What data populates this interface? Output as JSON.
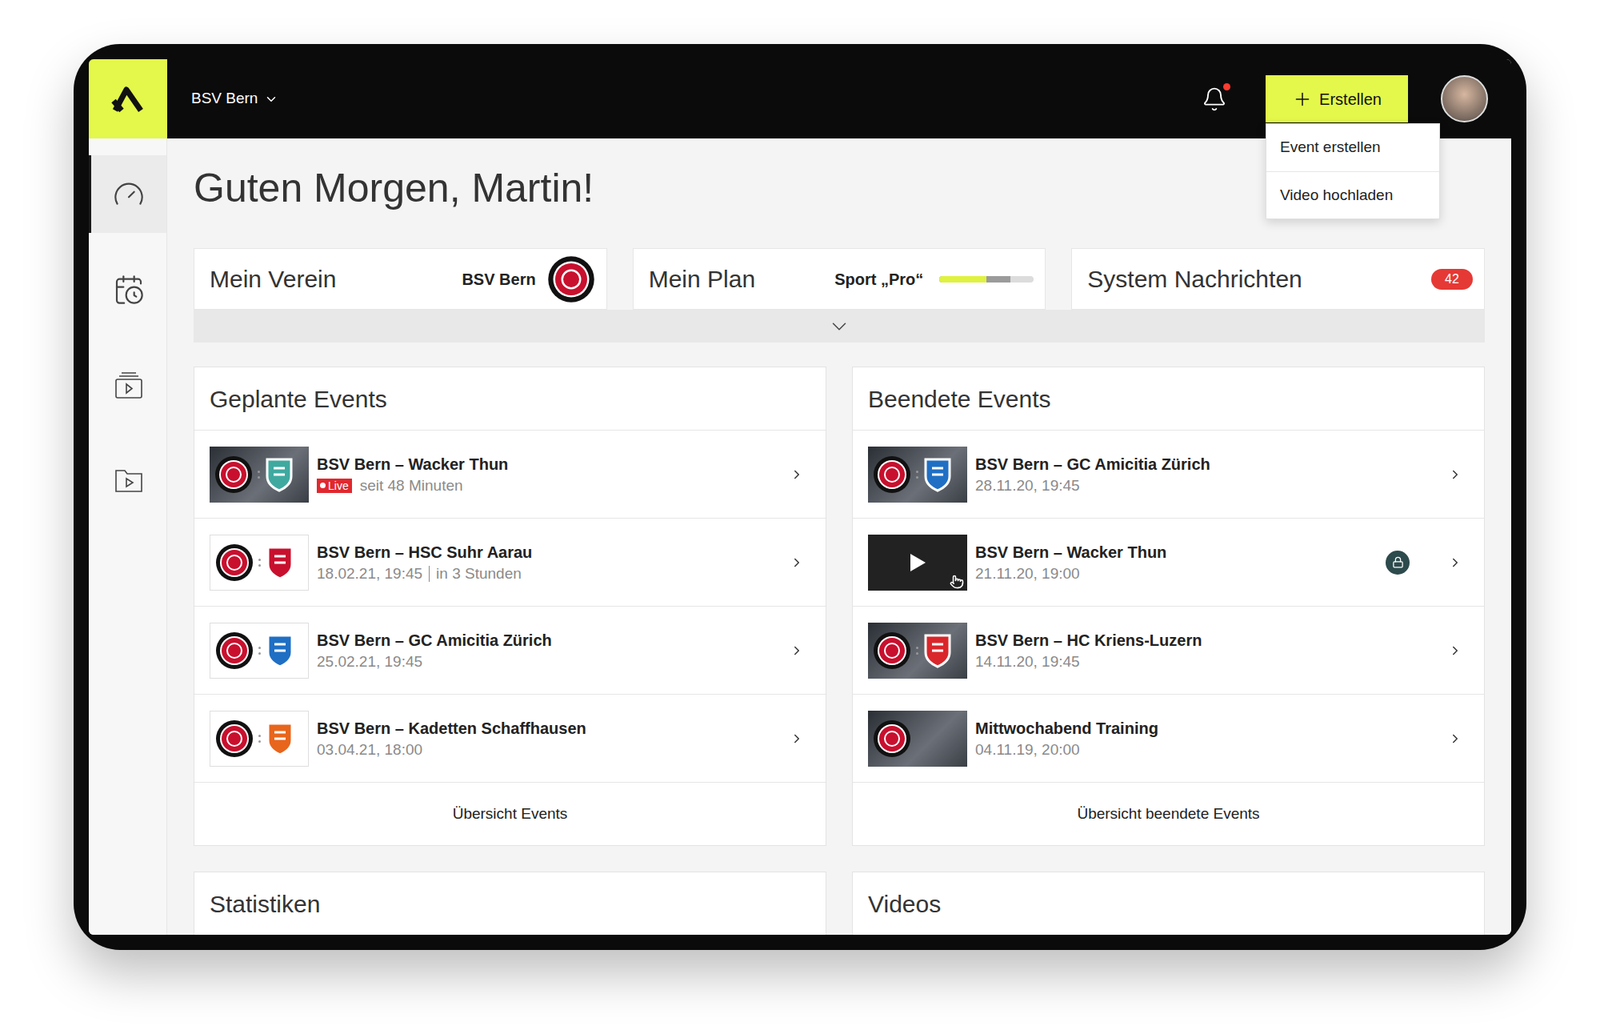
{
  "org_switcher": {
    "label": "BSV Bern",
    "expanded": false
  },
  "notifications": {
    "unread": true
  },
  "create_button": {
    "label": "Erstellen",
    "expanded": true,
    "menu": [
      "Event erstellen",
      "Video hochladen"
    ]
  },
  "sidebar": {
    "items": [
      {
        "kind": "dashboard",
        "selected": true
      },
      {
        "kind": "schedule",
        "selected": false
      },
      {
        "kind": "videos",
        "selected": false
      },
      {
        "kind": "media",
        "selected": false
      }
    ]
  },
  "greeting": "Guten Morgen, Martin!",
  "info_cards": [
    {
      "kind": "club",
      "title": "Mein Verein",
      "value": "BSV Bern"
    },
    {
      "kind": "plan",
      "title": "Mein Plan",
      "value": "Sport „Pro“",
      "level": 0.5,
      "secondary_level": 0.75
    },
    {
      "kind": "messages",
      "title": "System Nachrichten",
      "badge": "42"
    }
  ],
  "info_strip": {
    "expanded": false
  },
  "planned_events": {
    "title": "Geplante Events",
    "footer": "Übersicht Events",
    "items": [
      {
        "kind": "photo",
        "title": "BSV Bern – Wacker Thun",
        "live": true,
        "live_label": "Live",
        "date": "seit 48 Minuten",
        "relative": "",
        "locked": false,
        "color": "#3fa9a0"
      },
      {
        "kind": "plain",
        "title": "BSV Bern – HSC Suhr Aarau",
        "live": false,
        "live_label": "",
        "date": "18.02.21, 19:45",
        "relative": "in 3 Stunden",
        "locked": false,
        "color": "#c8102e"
      },
      {
        "kind": "plain",
        "title": "BSV Bern – GC Amicitia Zürich",
        "live": false,
        "live_label": "",
        "date": "25.02.21, 19:45",
        "relative": "",
        "locked": false,
        "color": "#1f6fc4"
      },
      {
        "kind": "plain",
        "title": "BSV Bern – Kadetten Schaffhausen",
        "live": false,
        "live_label": "",
        "date": "03.04.21, 18:00",
        "relative": "",
        "locked": false,
        "color": "#e8651c"
      }
    ]
  },
  "ended_events": {
    "title": "Beendete Events",
    "footer": "Übersicht beendete Events",
    "items": [
      {
        "kind": "photo",
        "title": "BSV Bern – GC Amicitia Zürich",
        "live": false,
        "live_label": "",
        "date": "28.11.20, 19:45",
        "relative": "",
        "locked": false,
        "color": "#1f6fc4"
      },
      {
        "kind": "video",
        "title": "BSV Bern – Wacker Thun",
        "live": false,
        "live_label": "",
        "date": "21.11.20, 19:00",
        "relative": "",
        "locked": true,
        "color": "#3fa9a0"
      },
      {
        "kind": "photo",
        "title": "BSV Bern – HC Kriens-Luzern",
        "live": false,
        "live_label": "",
        "date": "14.11.20, 19:45",
        "relative": "",
        "locked": false,
        "color": "#d9262b"
      },
      {
        "kind": "training",
        "title": "Mittwochabend Training",
        "live": false,
        "live_label": "",
        "date": "04.11.19, 20:00",
        "relative": "",
        "locked": false,
        "color": "#c8102e"
      }
    ]
  },
  "bottom_panels": [
    "Statistiken",
    "Videos"
  ]
}
